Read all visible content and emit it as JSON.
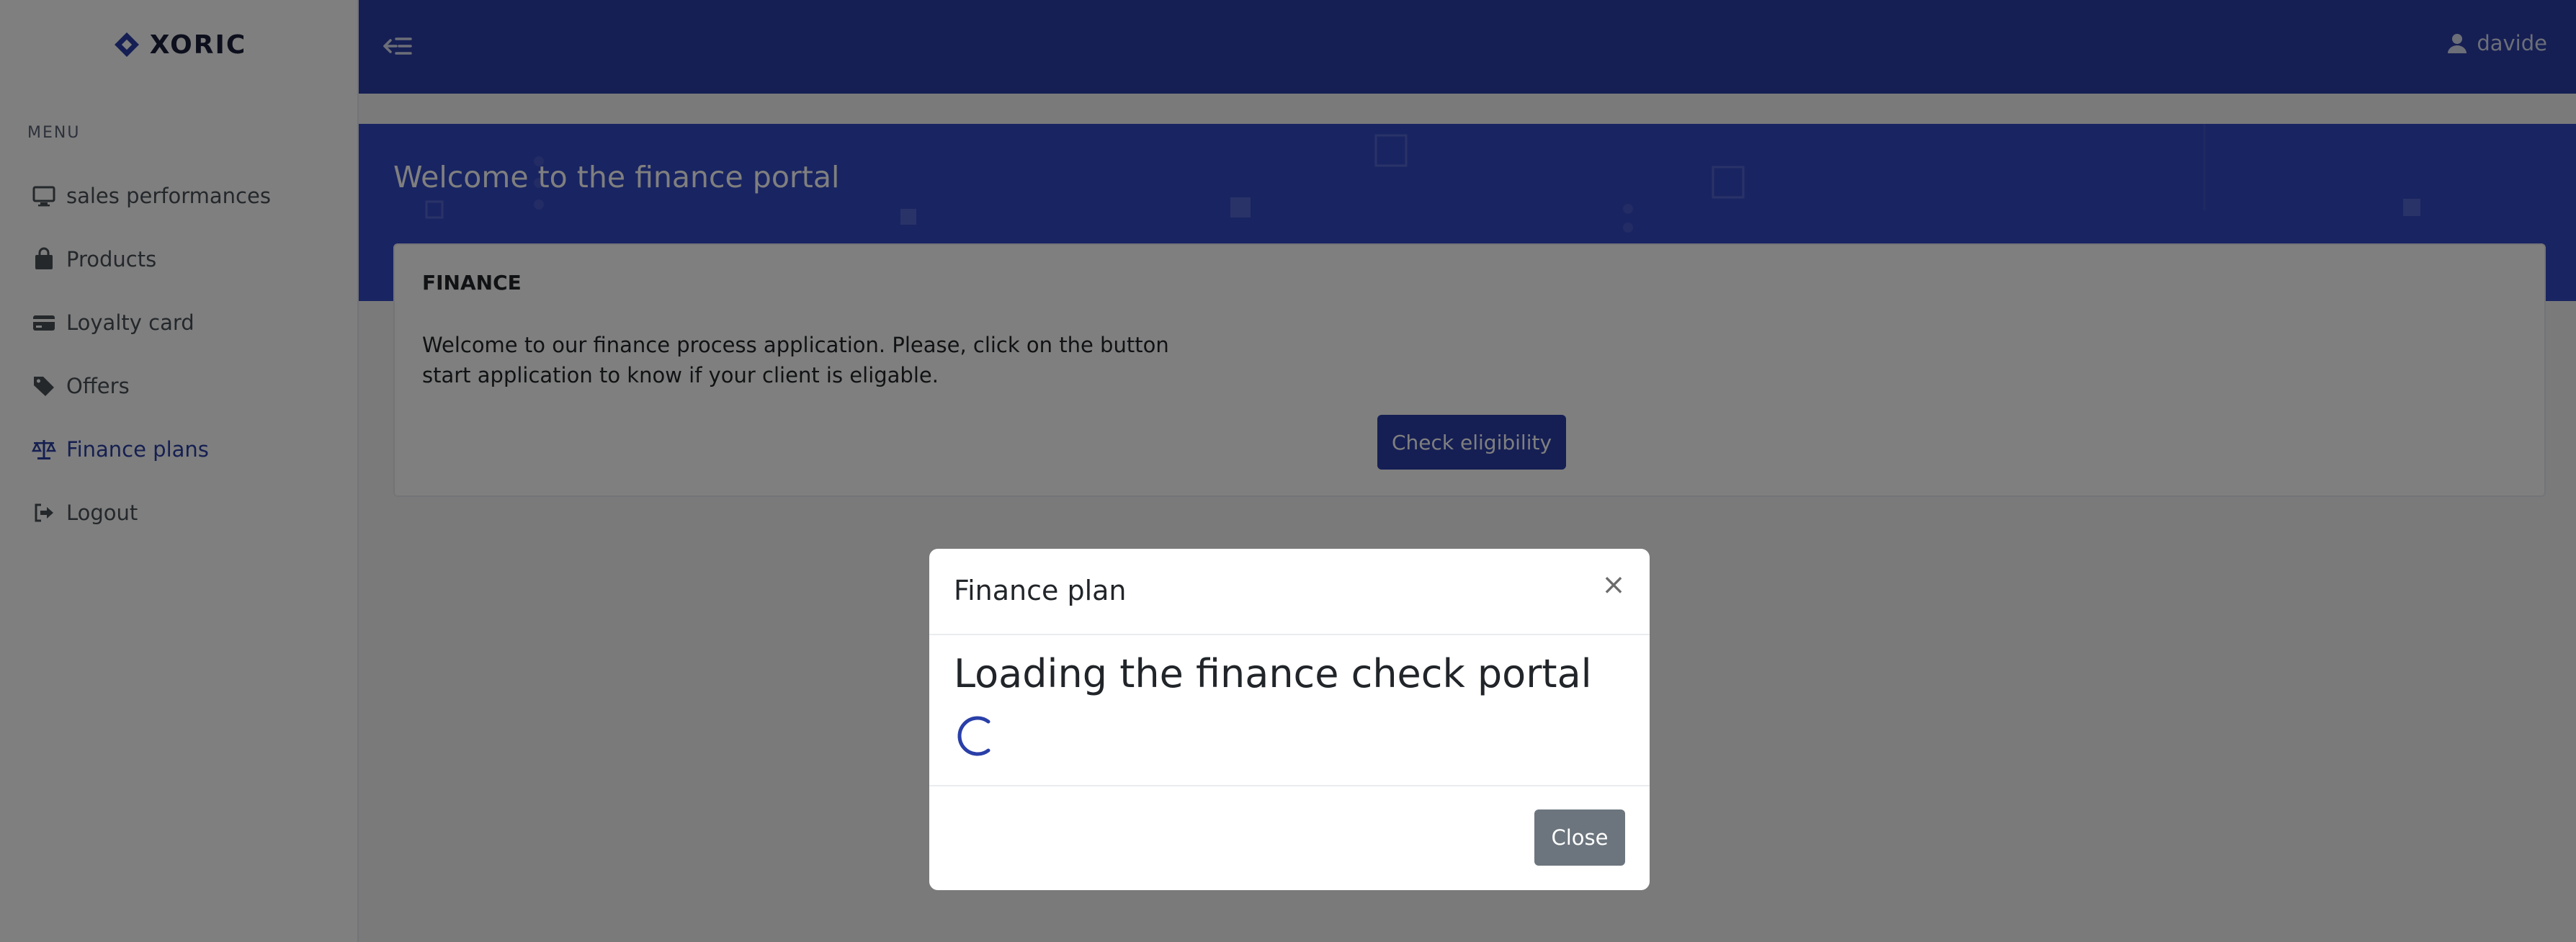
{
  "brand": {
    "name": "XORIC",
    "icon": "diamond-logo-icon"
  },
  "sidebar": {
    "heading": "MENU",
    "items": [
      {
        "label": "sales performances",
        "icon": "monitor-icon",
        "active": false
      },
      {
        "label": "Products",
        "icon": "shopping-bag-icon",
        "active": false
      },
      {
        "label": "Loyalty card",
        "icon": "credit-card-icon",
        "active": false
      },
      {
        "label": "Offers",
        "icon": "tag-icon",
        "active": false
      },
      {
        "label": "Finance plans",
        "icon": "balance-scale-icon",
        "active": true
      },
      {
        "label": "Logout",
        "icon": "sign-out-icon",
        "active": false
      }
    ]
  },
  "topbar": {
    "username": "davide",
    "toggle_icon": "menu-collapse-icon",
    "user_icon": "user-icon"
  },
  "hero": {
    "title": "Welcome to the finance portal"
  },
  "card": {
    "title": "FINANCE",
    "text": "Welcome to our finance process application. Please, click on the button start application to know if your client is eligable.",
    "button_label": "Check eligibility"
  },
  "modal": {
    "title": "Finance plan",
    "close_symbol": "×",
    "heading": "Loading the finance check portal",
    "close_button_label": "Close"
  },
  "colors": {
    "primary": "#2a3fa8",
    "hero": "#3348c4",
    "secondary_button": "#6c757d",
    "active_menu": "#2b3fa3"
  }
}
